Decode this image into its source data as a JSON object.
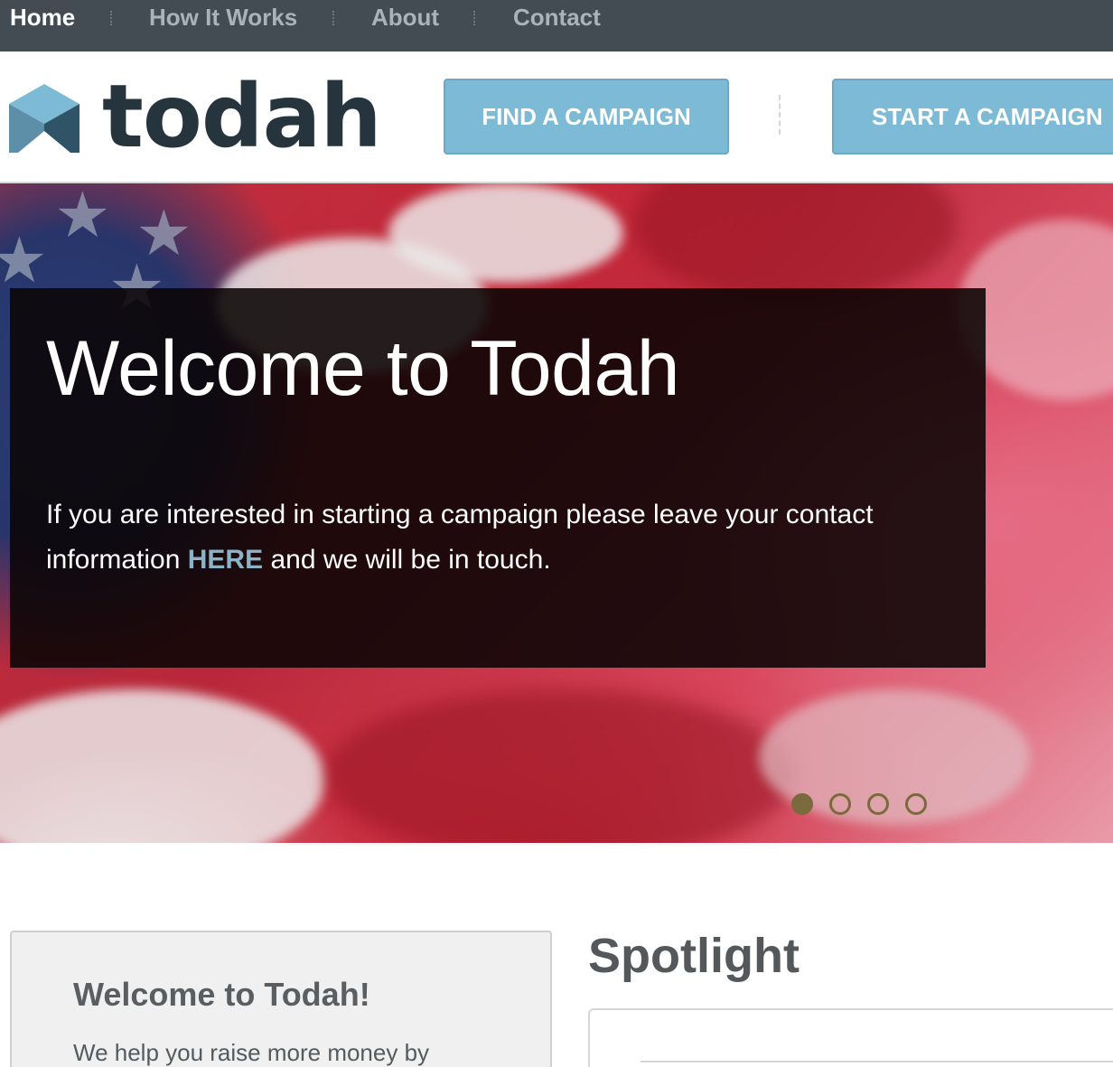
{
  "topnav": {
    "items": [
      "Home",
      "How It Works",
      "About",
      "Contact"
    ],
    "active": "Home"
  },
  "header": {
    "logo_text": "todah",
    "find_button": "FIND A CAMPAIGN",
    "start_button": "START A CAMPAIGN"
  },
  "hero": {
    "title": "Welcome to Todah",
    "body_before": "If you are interested in starting a campaign please leave your contact information",
    "link_text": "HERE",
    "body_after": "and we will be in touch.",
    "slides_total": 4,
    "slide_active": 1
  },
  "welcome_card": {
    "title": "Welcome to Todah!",
    "text": "We help you raise more money by"
  },
  "spotlight": {
    "title": "Spotlight"
  },
  "colors": {
    "nav_bg": "#434c52",
    "button_blue": "#7cbad6",
    "logo_dark": "#25343d",
    "link_blue": "#8ab3c6",
    "dot_color": "#7a6a3c"
  }
}
